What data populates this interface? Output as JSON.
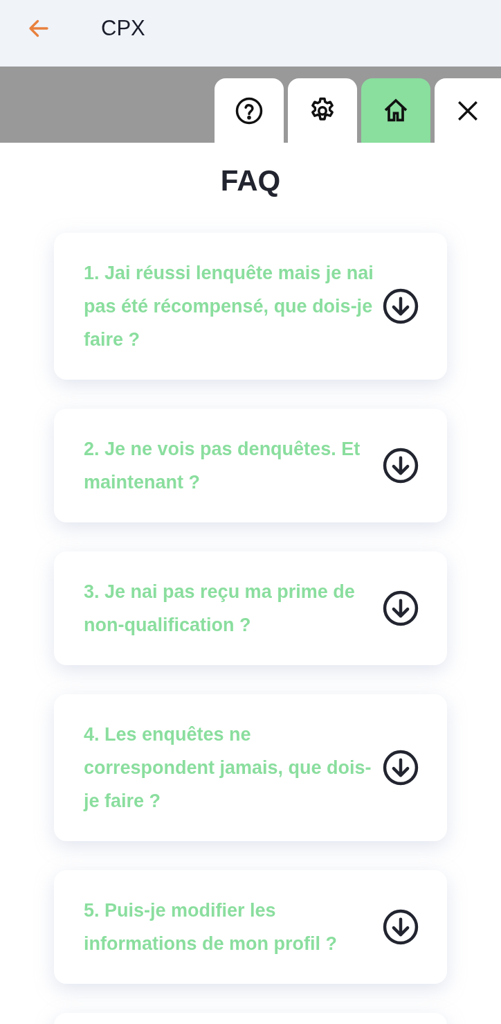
{
  "header": {
    "title": "CPX"
  },
  "tabs": [
    {
      "kind": "help",
      "selected": false
    },
    {
      "kind": "settings",
      "selected": false
    },
    {
      "kind": "home",
      "selected": true
    },
    {
      "kind": "close",
      "selected": false
    }
  ],
  "page_title": "FAQ",
  "faq": [
    {
      "question": "1. Jai réussi lenquête mais je nai pas été récompensé, que dois-je faire ?",
      "expanded": false
    },
    {
      "question": "2. Je ne vois pas denquêtes. Et maintenant ?",
      "expanded": false
    },
    {
      "question": "3. Je nai pas reçu ma prime de non-qualification ?",
      "expanded": false
    },
    {
      "question": "4. Les enquêtes ne correspondent jamais, que dois-je faire ?",
      "expanded": false
    },
    {
      "question": "5. Puis-je modifier les informations de mon profil ?",
      "expanded": false
    }
  ]
}
